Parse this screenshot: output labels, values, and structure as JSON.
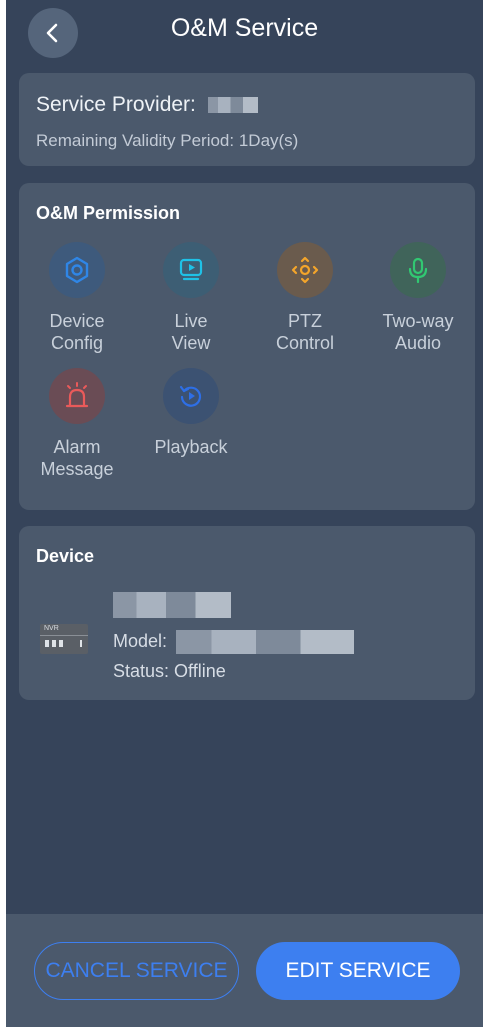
{
  "header": {
    "title": "O&M Service"
  },
  "provider": {
    "label": "Service Provider:",
    "validity": "Remaining Validity Period: 1Day(s)"
  },
  "permission": {
    "title": "O&M Permission",
    "items": [
      {
        "label": "Device Config",
        "icon": "settings-hexagon-icon",
        "color": "#2f86e6"
      },
      {
        "label": "Live View",
        "icon": "live-view-icon",
        "color": "#1fc1e6"
      },
      {
        "label": "PTZ Control",
        "icon": "ptz-control-icon",
        "color": "#f4a52a"
      },
      {
        "label": "Two-way Audio",
        "icon": "microphone-icon",
        "color": "#31c872"
      },
      {
        "label": "Alarm Message",
        "icon": "alarm-light-icon",
        "color": "#ea5a5a"
      },
      {
        "label": "Playback",
        "icon": "playback-icon",
        "color": "#2e6fe6"
      }
    ]
  },
  "device": {
    "title": "Device",
    "badge": "NVR",
    "model_label": "Model:",
    "status": "Status: Offline"
  },
  "actions": {
    "cancel": "CANCEL SERVICE",
    "edit": "EDIT SERVICE"
  },
  "colors": {
    "background": "#36445a",
    "card": "#4b596c",
    "accent": "#3d7ff0"
  }
}
